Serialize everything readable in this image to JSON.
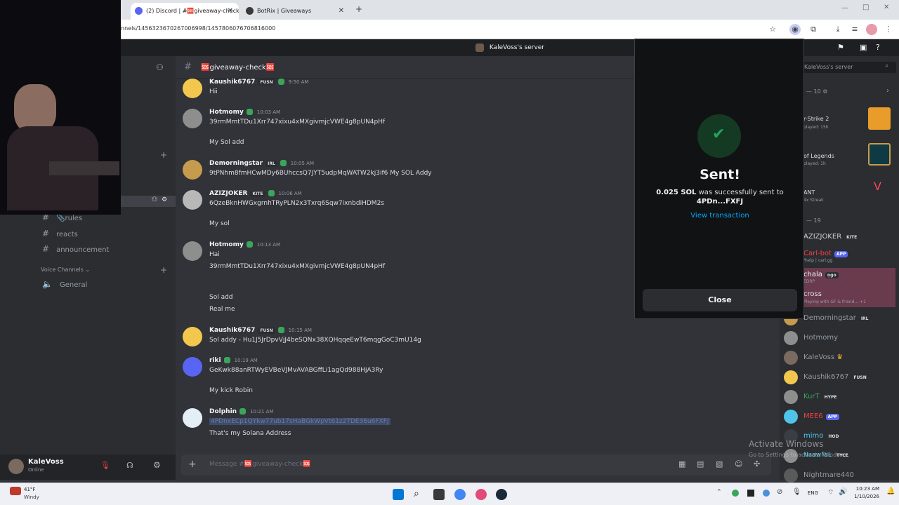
{
  "browser": {
    "tabs": [
      {
        "label": "(2) Discord | #🆘giveaway-check",
        "active": true
      },
      {
        "label": "BotRix | Giveaways",
        "active": false
      }
    ],
    "url": "nnels/1456323670267006998/1457806076706816000"
  },
  "server": {
    "name": "KaleVoss's server"
  },
  "sidebar": {
    "channels": [
      {
        "name": "rules"
      },
      {
        "name": "reacts"
      },
      {
        "name": "announcement"
      }
    ],
    "voice_header": "Voice Channels",
    "voice_channels": [
      {
        "name": "General"
      }
    ]
  },
  "user": {
    "name": "KaleVoss",
    "status": "Online"
  },
  "channel": {
    "name": "🆘giveaway-check🆘"
  },
  "messages": [
    {
      "user": "Kaushik6767",
      "badge": "FUSN",
      "time": "9:50 AM",
      "lines": [
        "Hii"
      ]
    },
    {
      "user": "Hotmomy",
      "badge": "",
      "time": "10:03 AM",
      "lines": [
        "39rmMmtTDu1Xrr747xixu4xMXgivmjcVWE4g8pUN4pHf",
        "",
        "My Sol add"
      ]
    },
    {
      "user": "Demorningstar",
      "badge": "IRL",
      "time": "10:05 AM",
      "lines": [
        "9tPNhm8fmHCwMDy6BUhccsQ7JYT5udpMqWATW2kj3if6 My SOL Addy"
      ]
    },
    {
      "user": "AZIZJOKER",
      "badge": "KITE",
      "time": "10:06 AM",
      "lines": [
        "6QzeBknHWGxgrnhTRyPLN2x3Txrq6Sqw7ixnbdiHDM2s",
        "",
        "My sol"
      ]
    },
    {
      "user": "Hotmomy",
      "badge": "",
      "time": "10:13 AM",
      "lines": [
        "Hai",
        "39rmMmtTDu1Xrr747xixu4xMXgivmjcVWE4g8pUN4pHf",
        "",
        "",
        "Sol add",
        "Real me"
      ]
    },
    {
      "user": "Kaushik6767",
      "badge": "FUSN",
      "time": "10:15 AM",
      "lines": [
        "Sol addy - Hu1J5JrDpvVjJ4beSQNx38XQHqqeEwT6mqgGoC3mU14g"
      ]
    },
    {
      "user": "riki",
      "badge": "",
      "time": "10:19 AM",
      "lines": [
        "GeKwk88anRTWyEVBeVJMvAVABGffLi1agQd988HjA3Ry",
        "",
        "My kick Robin"
      ]
    },
    {
      "user": "Dolphin",
      "badge": "",
      "time": "10:21 AM",
      "lines": [
        "4PDnxECp1QYkw77ub17sHaBGkWpVt61z2TDE36u6FXFJ",
        "That's my Solana Address"
      ]
    }
  ],
  "composer": {
    "placeholder": "Message #🆘giveaway-check🆘"
  },
  "modal": {
    "title": "Sent!",
    "amount": "0.025 SOL",
    "text": "was successfully sent to",
    "recipient": "4PDn...FXFJ",
    "link": "View transaction",
    "close": "Close"
  },
  "members": {
    "search": "KaleVoss's server",
    "count_a": "— 10",
    "count_b": "— 19",
    "activities": [
      {
        "title": "r-Strike 2",
        "sub": "played: 15h"
      },
      {
        "title": "of Legends",
        "sub": "played: 1h"
      },
      {
        "title": "ANT",
        "sub": "4x Streak"
      }
    ],
    "list": [
      {
        "name": "AZIZJOKER",
        "tag": "KITE"
      },
      {
        "name": "Carl-bot",
        "tag": "APP",
        "sub": "/help | carl.gg"
      },
      {
        "name": "chala",
        "tag": "ṇgo",
        "sub": "EDRP"
      },
      {
        "name": "cross",
        "sub": "Playing with GF & friend... +1"
      },
      {
        "name": "Demorningstar",
        "tag": "IRL"
      },
      {
        "name": "Hotmomy"
      },
      {
        "name": "KaleVoss"
      },
      {
        "name": "Kaushik6767",
        "tag": "FUSN"
      },
      {
        "name": "KurT",
        "tag": "HYPE"
      },
      {
        "name": "MEE6",
        "tag": "APP"
      },
      {
        "name": "mimo",
        "tag": "HOD"
      },
      {
        "name": "NaawFaL",
        "tag": "TYCE"
      },
      {
        "name": "Nightmare440"
      }
    ]
  },
  "watermark": {
    "line1": "Activate Windows",
    "line2": "Go to Settings to activate Windows."
  },
  "taskbar": {
    "weather_temp": "41°F",
    "weather_desc": "Windy",
    "lang": "ENG",
    "time": "10:23 AM",
    "date": "1/10/2026"
  },
  "colors": {
    "accent": "#5865f2",
    "success": "#23a55a",
    "link": "#00a8fc"
  }
}
